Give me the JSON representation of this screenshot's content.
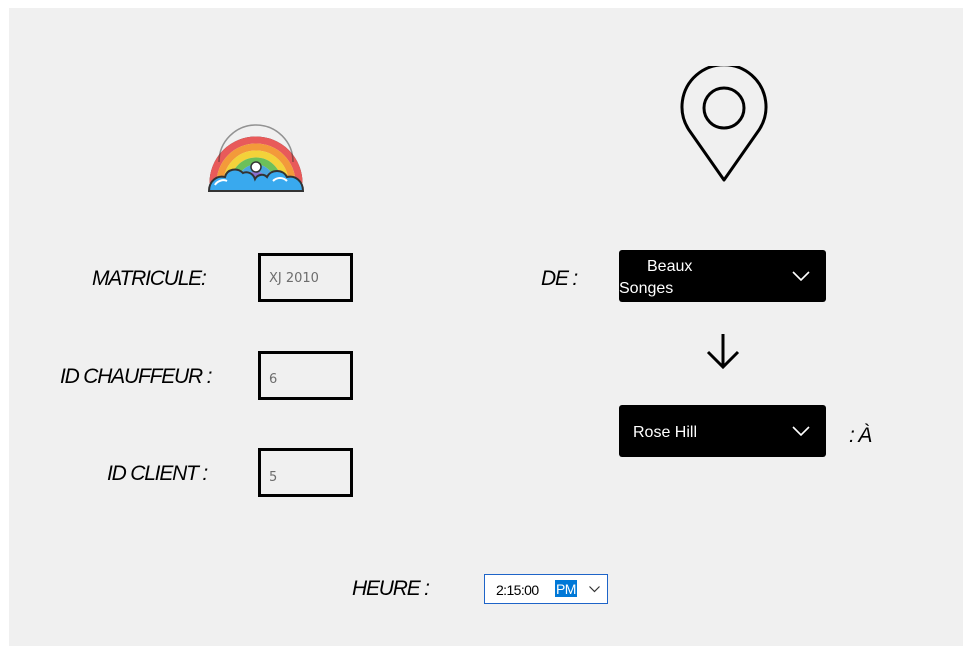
{
  "form": {
    "matricule": {
      "label": "MATRICULE:",
      "value": "XJ 2010"
    },
    "id_chauffeur": {
      "label": "ID CHAUFFEUR :",
      "value": "6"
    },
    "id_client": {
      "label": "ID CLIENT :",
      "value": "5"
    },
    "heure": {
      "label": "HEURE :",
      "time": "2:15:00",
      "period": "PM"
    }
  },
  "route": {
    "from": {
      "label": "DE :",
      "selected_line1": "Beaux",
      "selected_line2": "Songes"
    },
    "to": {
      "label": ": À",
      "selected": "Rose Hill"
    }
  },
  "icons": {
    "logo": "rainbow-cloud-icon",
    "location": "location-pin-icon",
    "direction": "arrow-down-icon"
  },
  "colors": {
    "background": "#f0f0f0",
    "combo_background": "#000000",
    "selection_highlight": "#0078d7",
    "focus_border": "#1e64c8"
  }
}
